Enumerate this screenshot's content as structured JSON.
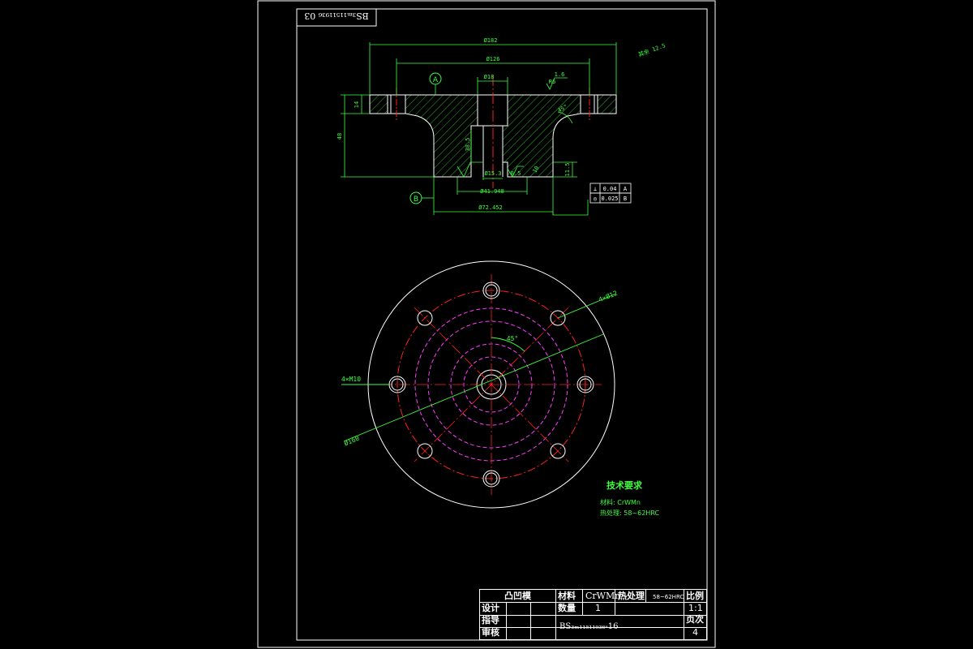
{
  "drawing": {
    "top_code": "BS₃ₘ₁₁₅₁₁₉₃₆ 03",
    "dims": {
      "overall_dia": "Ø182",
      "step_dia": "Ø126",
      "bore_top": "Ø18",
      "flange_thk": "14",
      "height": "48",
      "shaft_len": "38.5",
      "bore_small": "Ø15.3",
      "bore_mid": "Ø41.948",
      "shaft_dia": "Ø72.452",
      "chamfer": "0.5",
      "step": "11.5",
      "slot": "10",
      "fillet": "R6",
      "angle": "45°",
      "roughness_top": "1.6",
      "roughness_note": "其余 12.5"
    },
    "datum_a": "A",
    "datum_b": "B",
    "tolerances": [
      {
        "symbol": "⊥",
        "value": "0.04",
        "datum": "A"
      },
      {
        "symbol": "◎",
        "value": "0.025",
        "datum": "B"
      }
    ],
    "plan_labels": {
      "holes_top": "4×Ø12",
      "holes_left": "4×M10",
      "pcd": "Ø160",
      "angle": "45°"
    },
    "tech_req": {
      "title": "技术要求",
      "material": "材料: CrWMn",
      "heat": "热处理: 58~62HRC"
    }
  },
  "title_block": {
    "part_name": "凸凹模",
    "material_label": "材料",
    "material_value": "CrWMn",
    "heat_label": "热处理",
    "heat_value": "58~62HRC",
    "scale_label": "比例",
    "scale_value": "1:1",
    "design_label": "设计",
    "qty_label": "数量",
    "qty_value": "1",
    "guide_label": "指导",
    "pages_label": "页次",
    "pages_value": "4",
    "review_label": "审核",
    "drawing_no": "BS₃ₘ₁₁₅₁₁₉₃₆-16"
  },
  "colors": {
    "outline": "#ffffff",
    "dimension": "#3cff3c",
    "centerline": "#ff2020",
    "hidden": "#ff3cff",
    "hatch": "#3cff3c"
  }
}
